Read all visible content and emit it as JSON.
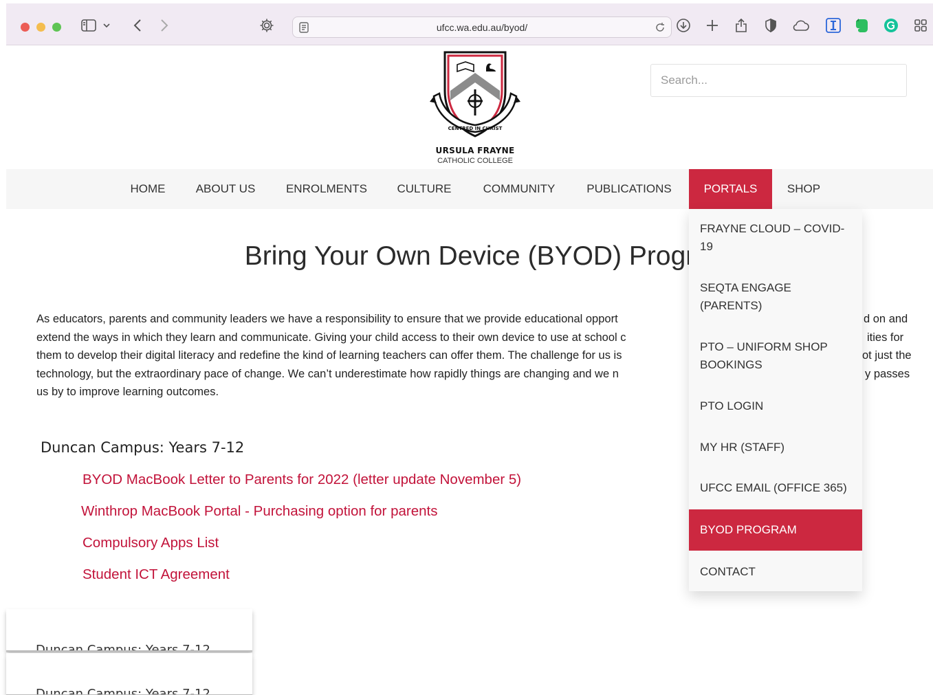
{
  "browser": {
    "url": "ufcc.wa.edu.au/byod/"
  },
  "site": {
    "logo_motto": "CENTRED IN CHRIST",
    "name_line1": "URSULA FRAYNE",
    "name_line2": "CATHOLIC COLLEGE",
    "search_placeholder": "Search...",
    "accent_color": "#cc2840"
  },
  "nav": {
    "items": [
      {
        "label": "HOME"
      },
      {
        "label": "ABOUT US"
      },
      {
        "label": "ENROLMENTS"
      },
      {
        "label": "CULTURE"
      },
      {
        "label": "COMMUNITY"
      },
      {
        "label": "PUBLICATIONS"
      },
      {
        "label": "PORTALS",
        "active": true
      },
      {
        "label": "SHOP"
      }
    ]
  },
  "portals_menu": {
    "items": [
      {
        "label": "FRAYNE CLOUD – COVID-19"
      },
      {
        "label": "SEQTA ENGAGE (PARENTS)"
      },
      {
        "label": "PTO – UNIFORM SHOP BOOKINGS"
      },
      {
        "label": "PTO LOGIN"
      },
      {
        "label": "MY HR (STAFF)"
      },
      {
        "label": "UFCC EMAIL (OFFICE 365)"
      },
      {
        "label": "BYOD PROGRAM",
        "active": true
      },
      {
        "label": "CONTACT"
      }
    ]
  },
  "main": {
    "title": "Bring Your Own Device (BYOD) Progr",
    "intro_lines": [
      "As educators, parents and community leaders we have a responsibility to ensure that we provide educational opport",
      "extend the ways in which they learn and communicate.  Giving your child access to their own device to use at school c",
      "them to develop their digital literacy and redefine the kind of learning teachers can offer them.  The challenge for us is",
      "technology, but the extraordinary pace of change. We can’t underestimate how rapidly things are changing and we n",
      "us by to improve learning outcomes."
    ],
    "intro_tail": [
      "d on and",
      "ities for",
      "ot just the",
      "y passes"
    ],
    "campus_heading": "Duncan Campus: Years 7-12",
    "links": [
      "BYOD MacBook Letter to Parents for 2022 (letter update November 5)",
      "Winthrop MacBook Portal - Purchasing option for parents",
      "Compulsory Apps List",
      "Student ICT Agreement"
    ],
    "thumb_text": "Duncan Campus: Years 7-12"
  }
}
